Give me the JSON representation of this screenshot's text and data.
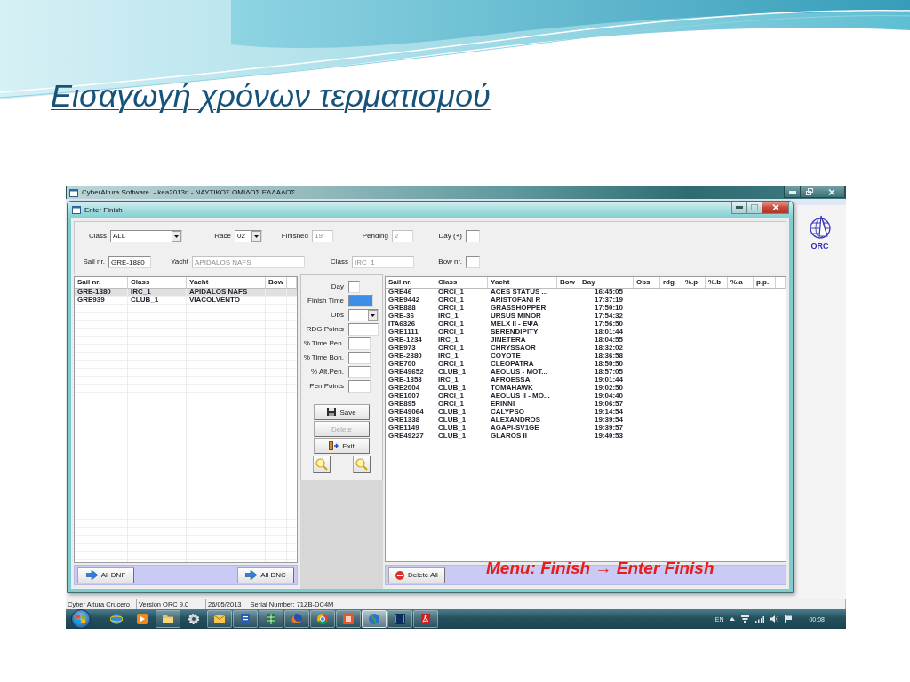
{
  "slide": {
    "title": "Εισαγωγή χρόνων τερματισμού",
    "annotation": "Menu: Finish → Enter Finish"
  },
  "app_window": {
    "title": "CyberAltura Software  - kea2013n - ΝΑΥΤΙΚΟΣ ΟΜΙΛΟΣ ΕΛΛΑΔΟΣ",
    "logo_text": "ORC"
  },
  "dialog": {
    "title": "Enter Finish"
  },
  "filter_row": [
    {
      "kind": "select",
      "label": "Class",
      "value": "ALL"
    },
    {
      "kind": "select",
      "label": "Race",
      "value": "02"
    },
    {
      "kind": "readonly",
      "label": "Finished",
      "value": "19"
    },
    {
      "kind": "readonly",
      "label": "Pending",
      "value": "2"
    },
    {
      "kind": "input",
      "label": "Day (+)"
    }
  ],
  "boat_row": [
    {
      "kind": "input",
      "label": "Sail nr.",
      "value": "GRE-1880"
    },
    {
      "kind": "readonly",
      "label": "Yacht",
      "value": "APIDALOS NAFS"
    },
    {
      "kind": "readonly",
      "label": "Class",
      "value": "IRC_1"
    },
    {
      "kind": "input",
      "label": "Bow nr."
    }
  ],
  "pending_list": {
    "columns": [
      "Sail nr.",
      "Class",
      "Yacht",
      "Bow"
    ],
    "rows": [
      {
        "sail_nr": "GRE-1880",
        "class": "IRC_1",
        "yacht": "APIDALOS NAFS",
        "selected": true
      },
      {
        "sail_nr": "GRE939",
        "class": "CLUB_1",
        "yacht": "VIACOLVENTO",
        "selected": false
      }
    ],
    "buttons": [
      "All DNF",
      "All DNC"
    ]
  },
  "entry_form": {
    "fields": [
      {
        "kind": "input",
        "label": "Day",
        "focused": false
      },
      {
        "kind": "input",
        "label": "Finish Time",
        "focused": true
      },
      {
        "kind": "select",
        "label": "Obs",
        "focused": false
      },
      {
        "kind": "input",
        "label": "RDG Points",
        "focused": false
      },
      {
        "kind": "input",
        "label": "% Time Pen.",
        "focused": false
      },
      {
        "kind": "input",
        "label": "% Time Bon.",
        "focused": false
      },
      {
        "kind": "input",
        "label": "% Alt.Pen.",
        "focused": false
      },
      {
        "kind": "input",
        "label": "Pen.Points",
        "focused": false
      }
    ],
    "actions": [
      {
        "kind": "save",
        "label": "Save",
        "disabled": false
      },
      {
        "kind": "delete",
        "label": "Delete",
        "disabled": true
      },
      {
        "kind": "exit",
        "label": "Exit",
        "disabled": false
      }
    ]
  },
  "finished_table": {
    "columns": [
      "Sail nr.",
      "Class",
      "Yacht",
      "Bow",
      "Day",
      "Obs",
      "rdg",
      "%.p",
      "%.b",
      "%.a",
      "p.p."
    ],
    "rows": [
      {
        "sail_nr": "GRE46",
        "class": "ORCI_1",
        "yacht": "ACES STATUS ...",
        "day": "16:45:05"
      },
      {
        "sail_nr": "GRE9442",
        "class": "ORCI_1",
        "yacht": "ARISTOFANI R",
        "day": "17:37:19"
      },
      {
        "sail_nr": "GRE888",
        "class": "ORCI_1",
        "yacht": "GRASSHOPPER",
        "day": "17:50:10"
      },
      {
        "sail_nr": "GRE-36",
        "class": "IRC_1",
        "yacht": "URSUS MINOR",
        "day": "17:54:32"
      },
      {
        "sail_nr": "ITA6326",
        "class": "ORCI_1",
        "yacht": "MELX II - EΨA",
        "day": "17:56:50"
      },
      {
        "sail_nr": "GRE1111",
        "class": "ORCI_1",
        "yacht": "SERENDIPITY",
        "day": "18:01:44"
      },
      {
        "sail_nr": "GRE-1234",
        "class": "IRC_1",
        "yacht": "JINETERA",
        "day": "18:04:55"
      },
      {
        "sail_nr": "GRE973",
        "class": "ORCI_1",
        "yacht": "CHRYSSAOR",
        "day": "18:32:02"
      },
      {
        "sail_nr": "GRE-2380",
        "class": "IRC_1",
        "yacht": "COYOTE",
        "day": "18:36:58"
      },
      {
        "sail_nr": "GRE700",
        "class": "ORCI_1",
        "yacht": "CLEOPATRA",
        "day": "18:50:50"
      },
      {
        "sail_nr": "GRE49652",
        "class": "CLUB_1",
        "yacht": "AEOLUS - MOT...",
        "day": "18:57:05"
      },
      {
        "sail_nr": "GRE-1353",
        "class": "IRC_1",
        "yacht": "AFROESSA",
        "day": "19:01:44"
      },
      {
        "sail_nr": "GRE2004",
        "class": "CLUB_1",
        "yacht": "TOMAHAWK",
        "day": "19:02:50"
      },
      {
        "sail_nr": "GRE1007",
        "class": "ORCI_1",
        "yacht": "AEOLUS II - MO...",
        "day": "19:04:40"
      },
      {
        "sail_nr": "GRE895",
        "class": "ORCI_1",
        "yacht": "ERINNI",
        "day": "19:06:57"
      },
      {
        "sail_nr": "GRE49064",
        "class": "CLUB_1",
        "yacht": "CALYPSO",
        "day": "19:14:54"
      },
      {
        "sail_nr": "GRE1338",
        "class": "CLUB_1",
        "yacht": "ALEXANDROS",
        "day": "19:39:54"
      },
      {
        "sail_nr": "GRE1149",
        "class": "CLUB_1",
        "yacht": "AGAPI-SV1GE",
        "day": "19:39:57"
      },
      {
        "sail_nr": "GRE49227",
        "class": "CLUB_1",
        "yacht": "GLAROS II",
        "day": "19:40:53"
      }
    ],
    "button": "Delete All"
  },
  "status_bar": [
    {
      "texts": [
        "Cyber Altura Crucero"
      ]
    },
    {
      "texts": [
        "Version ORC 9.0"
      ]
    },
    {
      "texts": [
        "26/05/2013",
        "Serial Number: 71ZB-DC4M"
      ]
    }
  ],
  "taskbar": {
    "apps": [
      {
        "kind": "browser",
        "running": false,
        "selected": false
      },
      {
        "kind": "media",
        "running": false,
        "selected": false
      },
      {
        "kind": "folder",
        "running": true,
        "selected": false
      },
      {
        "kind": "gear",
        "running": false,
        "selected": false
      },
      {
        "kind": "mail",
        "running": true,
        "selected": false
      },
      {
        "kind": "doc",
        "running": true,
        "selected": false
      },
      {
        "kind": "sheet",
        "running": true,
        "selected": false
      },
      {
        "kind": "fox",
        "running": true,
        "selected": false
      },
      {
        "kind": "wheel",
        "running": true,
        "selected": false
      },
      {
        "kind": "office",
        "running": true,
        "selected": false
      },
      {
        "kind": "earth",
        "running": true,
        "selected": true
      },
      {
        "kind": "ps",
        "running": true,
        "selected": false
      },
      {
        "kind": "pdf",
        "running": true,
        "selected": false
      }
    ],
    "language": "EN",
    "clock": "00:08"
  }
}
